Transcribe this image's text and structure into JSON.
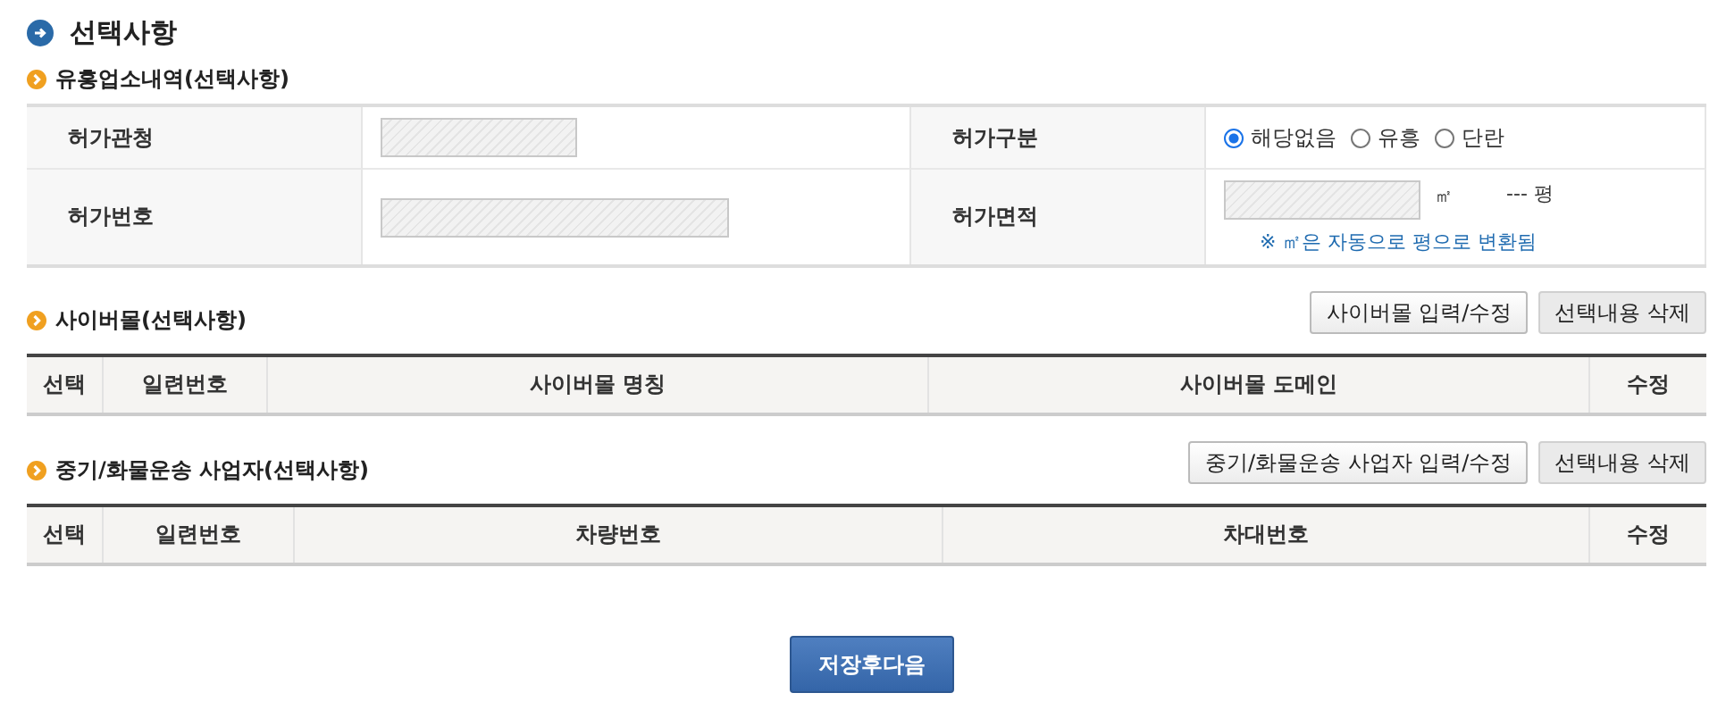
{
  "title": "선택사항",
  "business": {
    "heading": "유흥업소내역(선택사항)",
    "rows": [
      {
        "fields": [
          {
            "kind": "text",
            "label": "허가관청",
            "disabled": true
          },
          {
            "kind": "radio",
            "label": "허가구분",
            "options": [
              {
                "label": "해당없음",
                "selected": true
              },
              {
                "label": "유흥",
                "selected": false
              },
              {
                "label": "단란",
                "selected": false
              }
            ]
          }
        ]
      },
      {
        "fields": [
          {
            "kind": "text",
            "label": "허가번호",
            "disabled": true
          },
          {
            "kind": "area",
            "label": "허가면적",
            "disabled": true,
            "unit": "㎡",
            "converted": "--- 평",
            "note": "※ ㎡은 자동으로 평으로 변환됨"
          }
        ]
      }
    ]
  },
  "lists": [
    {
      "heading": "사이버몰(선택사항)",
      "buttons": [
        "사이버몰 입력/수정",
        "선택내용 삭제"
      ],
      "columns": [
        "선택",
        "일련번호",
        "사이버몰 명칭",
        "사이버몰 도메인",
        "수정"
      ]
    },
    {
      "heading": "중기/화물운송 사업자(선택사항)",
      "buttons": [
        "중기/화물운송 사업자 입력/수정",
        "선택내용 삭제"
      ],
      "columns": [
        "선택",
        "일련번호",
        "차량번호",
        "차대번호",
        "수정"
      ]
    }
  ],
  "save_button": "저장후다음"
}
